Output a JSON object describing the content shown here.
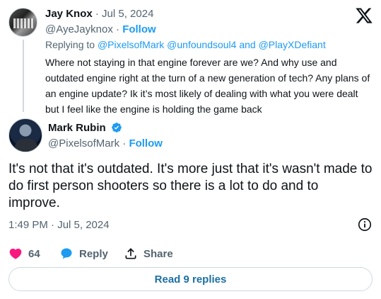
{
  "parent_tweet": {
    "author_name": "Jay Knox",
    "date": "· Jul 5, 2024",
    "handle": "@AyeJayknox",
    "dot": "·",
    "follow_label": "Follow",
    "replying_prefix": "Replying to",
    "replying_to": "@PixelsofMark @unfoundsoul4 and @PlayXDefiant",
    "text": "Where not staying in that engine forever are we? And why use and outdated engine right at the turn of a new generation of tech? Any plans of an engine update? Ik it’s most likely of dealing with what you were dealt but I feel like the engine is holding the game back"
  },
  "main_tweet": {
    "author_name": "Mark Rubin",
    "verified": true,
    "handle": "@PixelsofMark",
    "dot": "·",
    "follow_label": "Follow",
    "text": "It's not that it's outdated. It's more just that it's wasn't made to do first person shooters so there is a lot to do and to improve.",
    "timestamp": "1:49 PM · Jul 5, 2024"
  },
  "actions": {
    "like_count": "64",
    "reply_label": "Reply",
    "share_label": "Share"
  },
  "read_replies_label": "Read 9 replies",
  "colors": {
    "accent": "#1d9bf0",
    "like": "#f91880",
    "muted": "#536471",
    "text": "#0f1419"
  }
}
